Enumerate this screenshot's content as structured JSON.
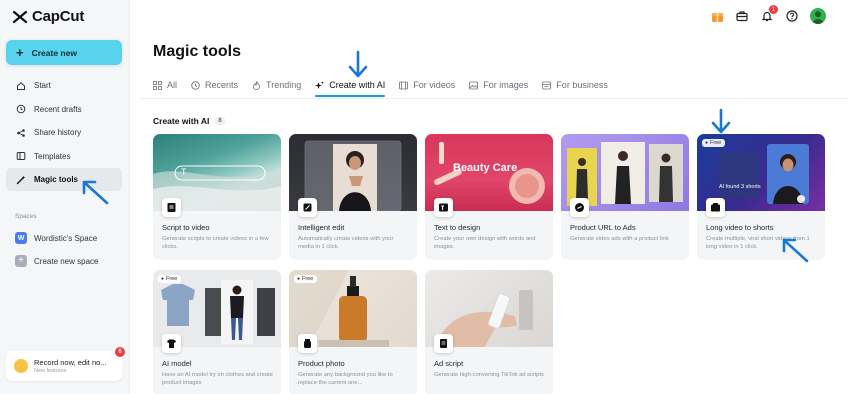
{
  "app": {
    "name": "CapCut",
    "create_label": "Create new"
  },
  "sidebar": {
    "items": [
      {
        "label": "Start",
        "icon": "home-icon"
      },
      {
        "label": "Recent drafts",
        "icon": "clock-icon"
      },
      {
        "label": "Share history",
        "icon": "share-icon"
      },
      {
        "label": "Templates",
        "icon": "templates-icon"
      },
      {
        "label": "Magic tools",
        "icon": "magic-wand-icon",
        "active": true
      }
    ],
    "spaces_label": "Spaces",
    "space_name": "Wordistic's Space",
    "space_initial": "W",
    "new_space_label": "Create new space",
    "promo": {
      "title": "Record now, edit no...",
      "subtitle": "New features",
      "count": "6"
    }
  },
  "header": {
    "notification_count": "1",
    "icons": [
      "gift-icon",
      "briefcase-icon",
      "bell-icon",
      "help-icon",
      "avatar"
    ]
  },
  "main": {
    "title": "Magic tools",
    "tabs": [
      {
        "label": "All"
      },
      {
        "label": "Recents"
      },
      {
        "label": "Trending"
      },
      {
        "label": "Create with AI",
        "active": true
      },
      {
        "label": "For videos"
      },
      {
        "label": "For images"
      },
      {
        "label": "For business"
      }
    ],
    "section_title": "Create with AI",
    "section_count": "8",
    "cards": [
      {
        "title": "Script to video",
        "desc": "Generate scripts to create videos in a few clicks.",
        "thumb_text": "T",
        "free": ""
      },
      {
        "title": "Intelligent edit",
        "desc": "Automatically create videos with your media in 1 click.",
        "thumb_text": "",
        "free": ""
      },
      {
        "title": "Text to design",
        "desc": "Create your own design with words and images.",
        "thumb_text": "Beauty Care",
        "free": ""
      },
      {
        "title": "Product URL to Ads",
        "desc": "Generate video ads with a product link",
        "thumb_text": "",
        "free": ""
      },
      {
        "title": "Long video to shorts",
        "desc": "Create multiple, viral short videos from 1 long video in 1 click.",
        "thumb_text": "AI found 3 shorts",
        "free": "Free"
      },
      {
        "title": "AI model",
        "desc": "Have an AI model try on clothes and create product images",
        "thumb_text": "",
        "free": "Free"
      },
      {
        "title": "Product photo",
        "desc": "Generate any background you like to replace the current one...",
        "thumb_text": "",
        "free": "Free"
      },
      {
        "title": "Ad script",
        "desc": "Generate high-converting TikTok ad scripts",
        "thumb_text": "",
        "free": ""
      }
    ]
  },
  "colors": {
    "accent": "#1b9bd8",
    "create_button": "#57d3ee",
    "sidebar_bg": "#f5f6f8",
    "annotation_arrow": "#1a78d2"
  }
}
